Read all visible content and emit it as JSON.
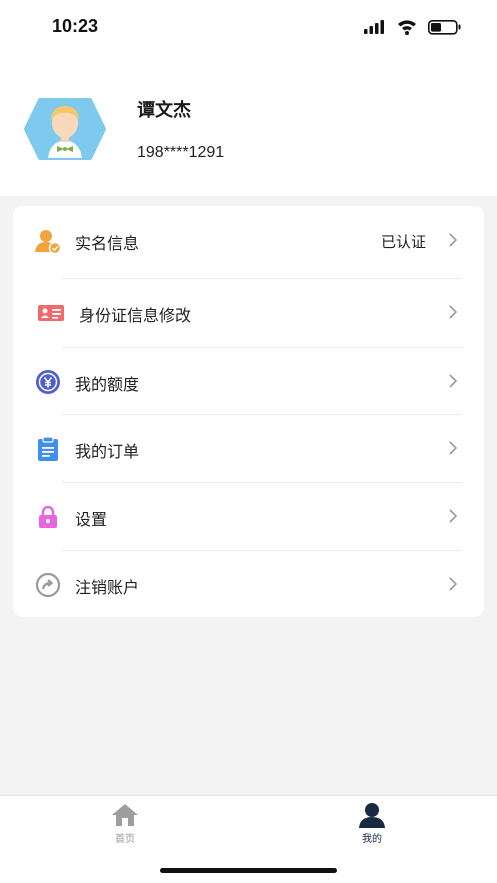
{
  "status_bar": {
    "time": "10:23"
  },
  "profile": {
    "name": "谭文杰",
    "phone": "198****1291"
  },
  "menu": {
    "items": [
      {
        "label": "实名信息",
        "value": "已认证",
        "icon": "user-verified-icon"
      },
      {
        "label": "身份证信息修改",
        "icon": "id-card-icon"
      },
      {
        "label": "我的额度",
        "icon": "yen-coin-icon"
      },
      {
        "label": "我的订单",
        "icon": "clipboard-icon"
      },
      {
        "label": "设置",
        "icon": "lock-icon"
      },
      {
        "label": "注销账户",
        "icon": "arrow-circle-icon"
      }
    ]
  },
  "tab_bar": {
    "items": [
      {
        "label": "首页",
        "icon": "home-icon",
        "active": false,
        "color": "#999999"
      },
      {
        "label": "我的",
        "icon": "person-icon",
        "active": true,
        "color": "#1a2a44"
      }
    ]
  },
  "colors": {
    "user_icon": "#f0a43a",
    "id_card_icon": "#ef6b6b",
    "yen_icon": "#4f5fd0",
    "clipboard_icon": "#3f8ff0",
    "lock_icon": "#e666e0",
    "arrow_icon": "#9a9a9a"
  }
}
